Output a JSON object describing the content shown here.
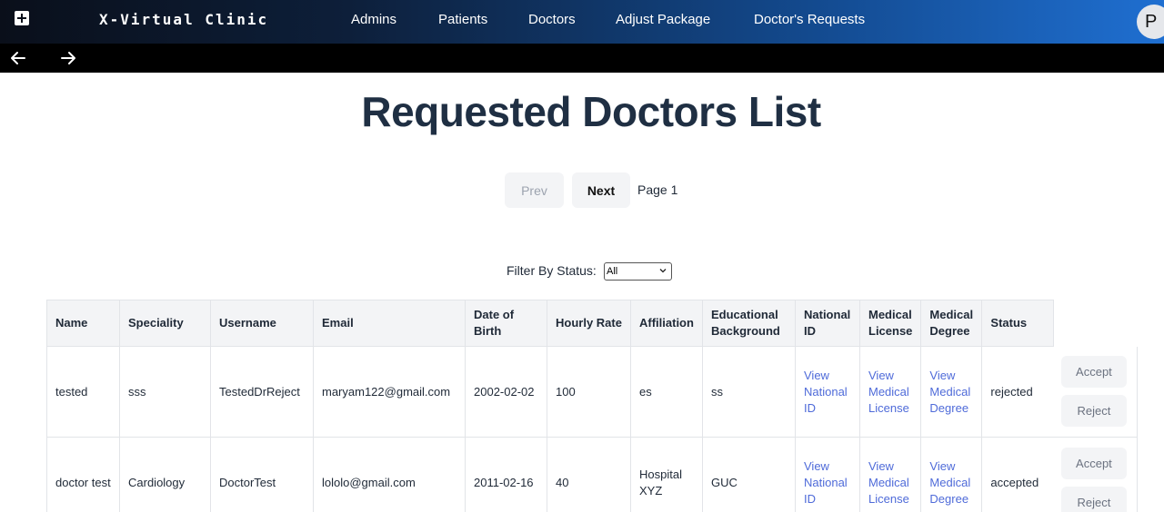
{
  "brand": "X-Virtual Clinic",
  "nav": [
    "Admins",
    "Patients",
    "Doctors",
    "Adjust Package",
    "Doctor's Requests"
  ],
  "avatar_initial": "P",
  "page_title": "Requested Doctors List",
  "pager": {
    "prev": "Prev",
    "next": "Next",
    "page_label": "Page 1"
  },
  "filter": {
    "label": "Filter By Status:",
    "selected": "All"
  },
  "table": {
    "headers": [
      "Name",
      "Speciality",
      "Username",
      "Email",
      "Date of Birth",
      "Hourly Rate",
      "Affiliation",
      "Educational Background",
      "National ID",
      "Medical License",
      "Medical Degree",
      "Status"
    ],
    "rows": [
      {
        "name": "tested",
        "speciality": "sss",
        "username": "TestedDrReject",
        "email": "maryam122@gmail.com",
        "dob": "2002-02-02",
        "rate": "100",
        "affiliation": "es",
        "education": "ss",
        "national_id": "View National ID",
        "license": "View Medical License",
        "degree": "View Medical Degree",
        "status": "rejected",
        "accept": "Accept",
        "reject": "Reject"
      },
      {
        "name": "doctor test",
        "speciality": "Cardiology",
        "username": "DoctorTest",
        "email": "lololo@gmail.com",
        "dob": "2011-02-16",
        "rate": "40",
        "affiliation": "Hospital XYZ",
        "education": "GUC",
        "national_id": "View National ID",
        "license": "View Medical License",
        "degree": "View Medical Degree",
        "status": "accepted",
        "accept": "Accept",
        "reject": "Reject"
      }
    ]
  },
  "icons": {
    "logo": "plus-square-icon",
    "back": "arrow-left-icon",
    "forward": "arrow-right-icon",
    "select": "chevron-down-icon"
  }
}
